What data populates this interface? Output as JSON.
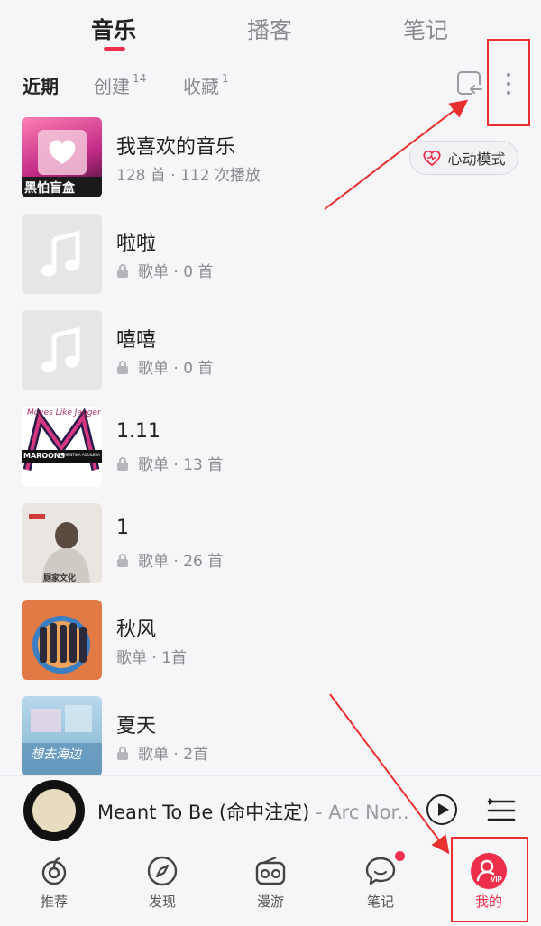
{
  "top_tabs": {
    "music": "音乐",
    "podcast": "播客",
    "notes": "笔记"
  },
  "sub_tabs": {
    "recent": "近期",
    "created": "创建",
    "created_count": "14",
    "favorites": "收藏",
    "favorites_count": "1"
  },
  "heart_mode": "心动模式",
  "playlists": [
    {
      "title": "我喜欢的音乐",
      "meta": "128 首 · 112 次播放"
    },
    {
      "title": "啦啦",
      "meta": "歌单 · 0 首"
    },
    {
      "title": "嘻嘻",
      "meta": "歌单 · 0 首"
    },
    {
      "title": "1.11",
      "meta": "歌单 · 13 首"
    },
    {
      "title": "1",
      "meta": "歌单 · 26 首"
    },
    {
      "title": "秋风",
      "meta": "歌单 · 1首"
    },
    {
      "title": "夏天",
      "meta": "歌单 · 2首"
    }
  ],
  "covers": {
    "first_caption": "黑怕盲盒",
    "maroon_band": "MAROON5",
    "maroon_text": "Moves Like Jagger",
    "maroon_featuring": "CHRISTINA AGUILERA",
    "culture_label": "厕家文化",
    "summer_text": "想去海边"
  },
  "player": {
    "song": "Meant To Be (命中注定)",
    "artist": " - Arc Nor..."
  },
  "bottom_nav": {
    "recommend": "推荐",
    "discover": "发现",
    "roam": "漫游",
    "notes": "笔记",
    "mine": "我的"
  },
  "colors": {
    "accent": "#ee2f4a",
    "annotation": "#e8302f"
  }
}
